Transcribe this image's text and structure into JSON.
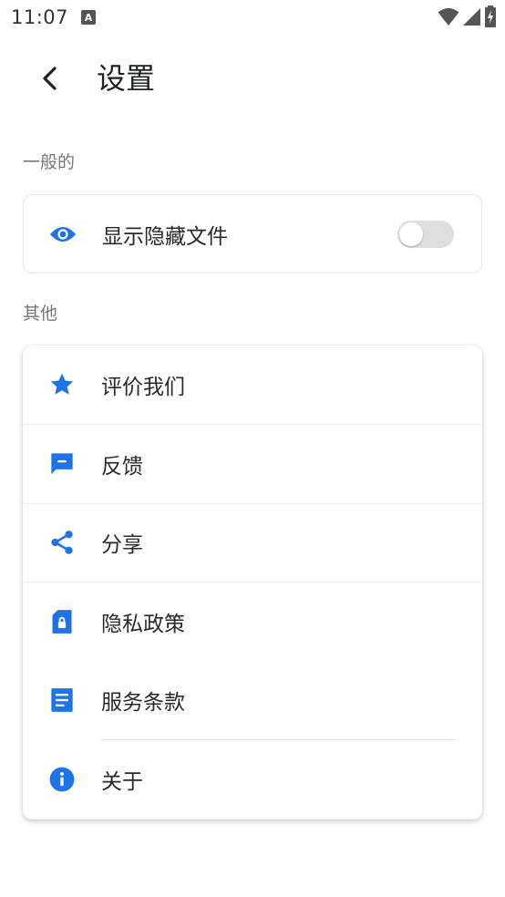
{
  "status_bar": {
    "time": "11:07",
    "notification_icon": "A"
  },
  "header": {
    "title": "设置"
  },
  "sections": {
    "general": {
      "label": "一般的",
      "items": [
        {
          "label": "显示隐藏文件",
          "icon": "eye-icon",
          "toggle_on": false
        }
      ]
    },
    "other": {
      "label": "其他",
      "items": [
        {
          "label": "评价我们",
          "icon": "star-icon"
        },
        {
          "label": "反馈",
          "icon": "feedback-icon"
        },
        {
          "label": "分享",
          "icon": "share-icon"
        },
        {
          "label": "隐私政策",
          "icon": "privacy-lock-icon"
        },
        {
          "label": "服务条款",
          "icon": "document-icon"
        },
        {
          "label": "关于",
          "icon": "info-icon"
        }
      ]
    }
  },
  "colors": {
    "accent": "#1e73e8",
    "toggle_off": "#dedede",
    "section_label": "#777777"
  }
}
